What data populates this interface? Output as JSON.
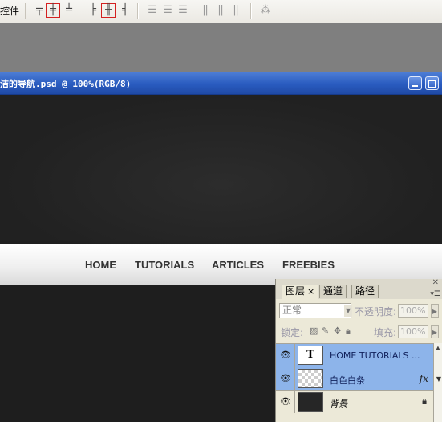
{
  "toolbar": {
    "label": "控件",
    "align_icons": [
      "align-top-edges-icon",
      "align-vertical-centers-icon",
      "align-bottom-edges-icon",
      "align-left-edges-icon",
      "align-horizontal-centers-icon",
      "align-right-edges-icon"
    ],
    "active_align": "align-horizontal-centers-icon",
    "distribute_icons": [
      "distribute-top-icon",
      "distribute-vcenter-icon",
      "distribute-bottom-icon",
      "distribute-left-icon",
      "distribute-hcenter-icon",
      "distribute-right-icon"
    ],
    "auto_align_icon": "auto-align-layers-icon"
  },
  "document": {
    "title": "洁的导航.psd @ 100%(RGB/8)",
    "nav_items": [
      "HOME",
      "TUTORIALS",
      "ARTICLES",
      "FREEBIES"
    ]
  },
  "layers_panel": {
    "tabs": [
      {
        "label": "图层",
        "active": true,
        "close": "×"
      },
      {
        "label": "通道",
        "active": false
      },
      {
        "label": "路径",
        "active": false
      }
    ],
    "blend_mode": "正常",
    "opacity_label": "不透明度:",
    "opacity_value": "100%",
    "lock_label": "锁定:",
    "fill_label": "填充:",
    "fill_value": "100%",
    "layers": [
      {
        "name": "HOME  TUTORIALS  ...",
        "thumb": "T",
        "selected": true
      },
      {
        "name": "白色白条",
        "selected": true,
        "fx": "fx"
      },
      {
        "name": "背景",
        "selected": false
      }
    ]
  },
  "colors": {
    "titlebar": "#2a5cc0",
    "selection": "#8db4ea",
    "canvas": "#222222",
    "nav_text": "#333333"
  }
}
